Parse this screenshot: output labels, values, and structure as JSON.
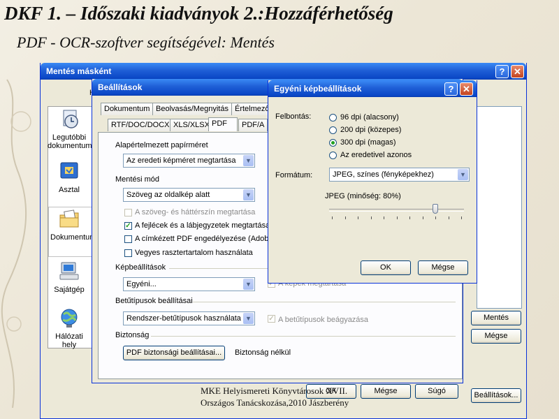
{
  "slide": {
    "title": "DKF 1. – Időszaki kiadványok 2.:Hozzáférhetőség",
    "subtitle": "PDF - OCR-szoftver segítségével: Mentés",
    "footer_line1": "MKE Helyismereti Könyvtárosok XVII.",
    "footer_line2": "Országos Tanácskozása,2010 Jászberény"
  },
  "save_as": {
    "title": "Mentés másként",
    "help": "?",
    "close": "✕",
    "letter_fragment": "H",
    "places": [
      {
        "label": "Legutóbbi dokumentum",
        "icon": "recent-documents-icon"
      },
      {
        "label": "Asztal",
        "icon": "desktop-icon"
      },
      {
        "label": "Dokumentum",
        "icon": "my-documents-icon"
      },
      {
        "label": "Sajátgép",
        "icon": "my-computer-icon"
      },
      {
        "label": "Hálózati hely",
        "icon": "network-places-icon"
      }
    ],
    "save_button": "Mentés",
    "cancel_button": "Mégse",
    "settings_button": "Beállítások..."
  },
  "settings": {
    "title": "Beállítások",
    "tabs_row1": [
      "Dokumentum",
      "Beolvasás/Megnyitás",
      "Értelmező"
    ],
    "tabs_row2": [
      "RTF/DOC/DOCX",
      "XLS/XLSX",
      "PDF",
      "PDF/A"
    ],
    "active_tab": "PDF",
    "paper_heading": "Alapértelmezett papírméret",
    "paper_value": "Az eredeti képméret megtartása",
    "mode_heading": "Mentési mód",
    "mode_value": "Szöveg az oldalkép alatt",
    "checks": [
      {
        "label": "A szöveg- és háttérszín megtartása",
        "checked": false,
        "disabled": true
      },
      {
        "label": "A fejlécek és a lábjegyzetek megtartása",
        "checked": true,
        "disabled": false
      },
      {
        "label": "A címkézett PDF engedélyezése (Adobe",
        "checked": false,
        "disabled": false
      },
      {
        "label": "Vegyes raszter­tartalom használata",
        "checked": false,
        "disabled": false
      }
    ],
    "image_heading": "Képbeállítások",
    "image_value": "Egyéni...",
    "keep_images_label": "A képek megtartása",
    "fonts_heading": "Betűtípusok beállításai",
    "fonts_value": "Rendszer-betűtípusok használata",
    "embed_fonts_label": "A betűtípusok beágyazása",
    "security_heading": "Biztonság",
    "security_button": "PDF biztonsági beállításai...",
    "security_status": "Biztonság nélkül",
    "ok_button": "OK",
    "cancel_button": "Mégse",
    "help_button": "Súgó"
  },
  "custom_image": {
    "title": "Egyéni képbeállítások",
    "help": "?",
    "close": "✕",
    "resolution_label": "Felbontás:",
    "resolutions": [
      {
        "label": "96 dpi (alacsony)",
        "selected": false
      },
      {
        "label": "200 dpi (közepes)",
        "selected": false
      },
      {
        "label": "300 dpi (magas)",
        "selected": true
      },
      {
        "label": "Az eredetivel azonos",
        "selected": false
      }
    ],
    "format_label": "Formátum:",
    "format_value": "JPEG, színes (fényképekhez)",
    "quality_label": "JPEG (minőség: 80%)",
    "quality_value": 80,
    "ok_button": "OK",
    "cancel_button": "Mégse"
  },
  "colors": {
    "titlebar": "#0b47c7",
    "dialog_bg": "#ece9d8",
    "check_green": "#21a121"
  }
}
